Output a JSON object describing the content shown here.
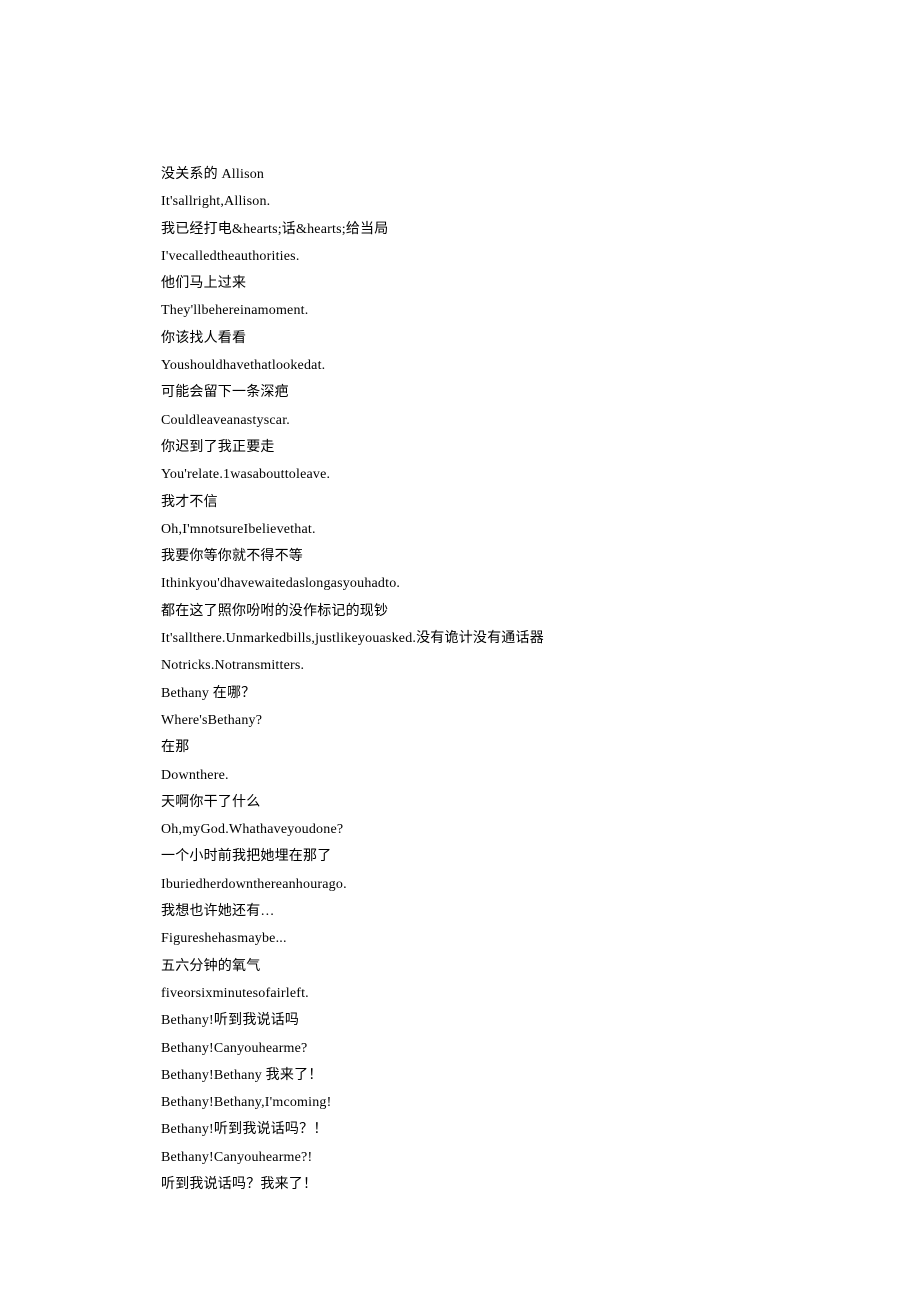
{
  "lines": [
    "没关系的 Allison",
    "It'sallright,Allison.",
    "我已经打电&hearts;话&hearts;给当局",
    "I'vecalledtheauthorities.",
    "他们马上过来",
    "They'llbehereinamoment.",
    "你该找人看看",
    "Youshouldhavethatlookedat.",
    "可能会留下一条深疤",
    "Couldleaveanastyscar.",
    "你迟到了我正要走",
    "You'relate.1wasabouttoleave.",
    "我才不信",
    "Oh,I'mnotsureIbelievethat.",
    "我要你等你就不得不等",
    "Ithinkyou'dhavewaitedaslongasyouhadto.",
    "都在这了照你吩咐的没作标记的现钞",
    "It'sallthere.Unmarkedbills,justlikeyouasked.没有诡计没有通话器",
    "Notricks.Notransmitters.",
    "Bethany 在哪？",
    "Where'sBethany?",
    "在那",
    "Downthere.",
    "天啊你干了什么",
    "Oh,myGod.Whathaveyoudone?",
    "一个小时前我把她埋在那了",
    "Iburiedherdownthereanhourago.",
    "我想也许她还有…",
    "Figureshehasmaybe...",
    "五六分钟的氧气",
    "fiveorsixminutesofairleft.",
    "Bethany!听到我说话吗",
    "Bethany!Canyouhearme?",
    "Bethany!Bethany 我来了！",
    "Bethany!Bethany,I'mcoming!",
    "Bethany!听到我说话吗？！",
    "Bethany!Canyouhearme?!",
    "听到我说话吗？我来了！"
  ]
}
